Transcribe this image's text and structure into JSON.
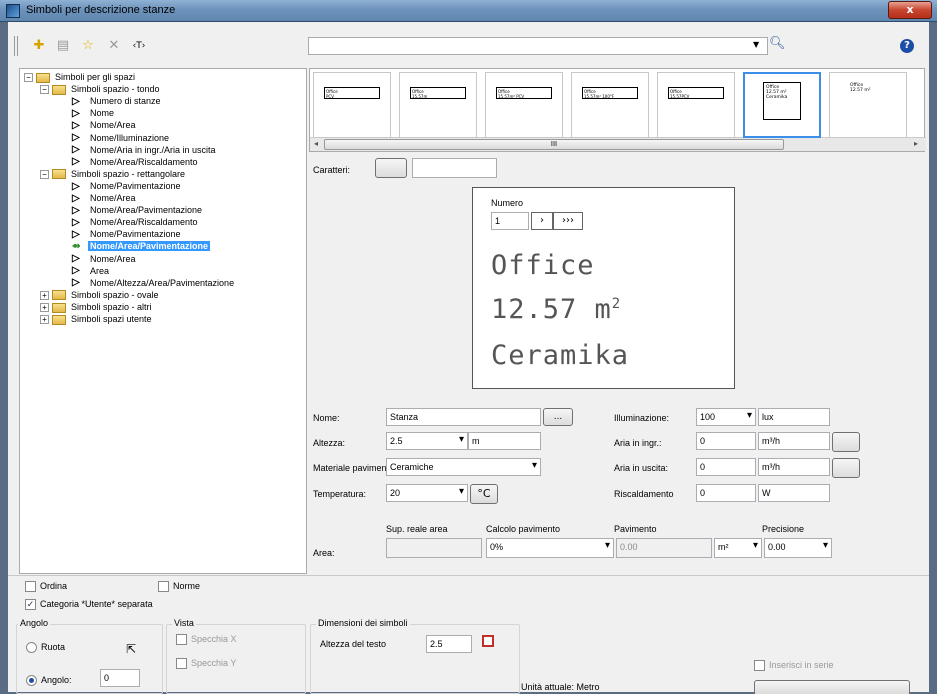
{
  "window": {
    "title": "Simboli per descrizione stanze",
    "close_label": "x"
  },
  "toolbar": {
    "new_icon": "✚",
    "list_icon": "▤",
    "star_icon": "☆",
    "delete_icon": "✕",
    "text_icon": "‹T›",
    "search_value": "",
    "help_label": "?"
  },
  "tree": {
    "root": "Simboli per gli spazi",
    "groups": [
      {
        "label": "Simboli spazio - tondo",
        "items": [
          "Numero di stanze",
          "Nome",
          "Nome/Area",
          "Nome/Illuminazione",
          "Nome/Aria in ingr./Aria in uscita",
          "Nome/Area/Riscaldamento"
        ]
      },
      {
        "label": "Simboli spazio - rettangolare",
        "items": [
          "Nome/Pavimentazione",
          "Nome/Area",
          "Nome/Area/Pavimentazione",
          "Nome/Area/Riscaldamento",
          "Nome/Pavimentazione",
          "Nome/Area/Pavimentazione",
          "Nome/Area",
          "Area",
          "Nome/Altezza/Area/Pavimentazione"
        ]
      },
      {
        "label": "Simboli spazio - ovale"
      },
      {
        "label": "Simboli spazio - altri"
      },
      {
        "label": "Simboli spazi utente"
      }
    ]
  },
  "thumbs": [
    {
      "l1": "Office",
      "l2": "PCV"
    },
    {
      "l1": "Office",
      "l2": "15.57m"
    },
    {
      "l1": "Office",
      "l2": "15.57m² PCV"
    },
    {
      "l1": "Office",
      "l2": "15.57m² 100°F"
    },
    {
      "l1": "Office",
      "l2": "15.57PCV"
    },
    {
      "l1": "Office",
      "l2": "12.57 m²",
      "l3": "Ceramika"
    },
    {
      "l1": "Office",
      "l2": "12.57 m²"
    }
  ],
  "scroll_label": "III",
  "caratteri": {
    "label": "Caratteri:",
    "value": ""
  },
  "preview": {
    "numero_label": "Numero",
    "numero_value": "1",
    "next": "›",
    "next2": "›››",
    "line1": "Office",
    "line2": "12.57 m",
    "line2_sup": "2",
    "line3": "Ceramika"
  },
  "form": {
    "nome_label": "Nome:",
    "nome_value": "Stanza",
    "nome_btn": "...",
    "altezza_label": "Altezza:",
    "altezza_value": "2.5",
    "altezza_unit": "m",
    "materiale_label": "Materiale pavimento:",
    "materiale_value": "Ceramiche",
    "temperatura_label": "Temperatura:",
    "temperatura_value": "20",
    "temperatura_unit": "°C",
    "illum_label": "Illuminazione:",
    "illum_value": "100",
    "illum_unit": "lux",
    "aria_in_label": "Aria in ingr.:",
    "aria_in_value": "0",
    "aria_in_unit": "m³/h",
    "aria_out_label": "Aria in uscita:",
    "aria_out_value": "0",
    "aria_out_unit": "m³/h",
    "risc_label": "Riscaldamento",
    "risc_value": "0",
    "risc_unit": "W",
    "area_label": "Area:",
    "sup_label": "Sup. reale area",
    "sup_value": "",
    "calcolo_label": "Calcolo pavimento",
    "calcolo_value": "0%",
    "pav_label": "Pavimento",
    "pav_value": "0.00",
    "pav_unit": "m²",
    "prec_label": "Precisione",
    "prec_value": "0.00"
  },
  "bottom": {
    "ordina": "Ordina",
    "norme": "Norme",
    "categoria": "Categoria *Utente* separata",
    "angolo_title": "Angolo",
    "ruota": "Ruota",
    "angolo_label": "Angolo:",
    "angolo_value": "0",
    "vista_title": "Vista",
    "specchia_x": "Specchia X",
    "specchia_y": "Specchia Y",
    "dim_title": "Dimensioni dei simboli",
    "altezza_testo_label": "Altezza del testo",
    "altezza_testo_value": "2.5",
    "unita": "Unità attuale: Metro",
    "inserisci": "Inserisci in serie"
  }
}
